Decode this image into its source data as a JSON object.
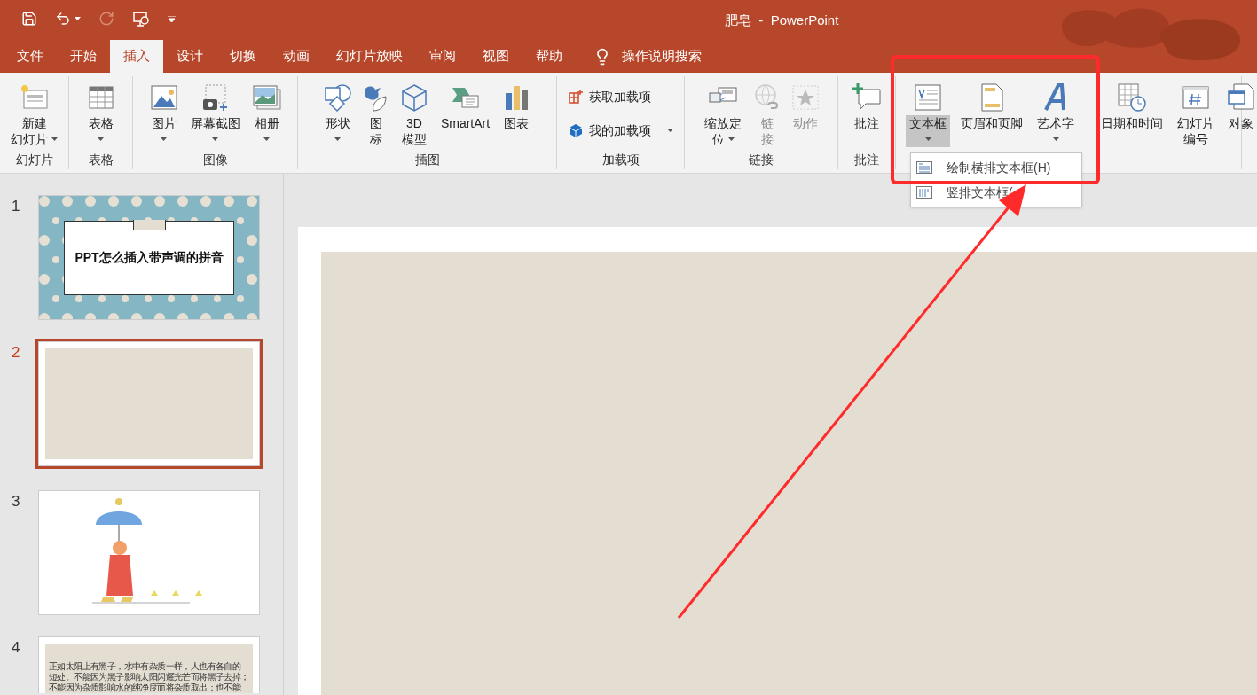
{
  "window": {
    "title": "肥皂  -  PowerPoint"
  },
  "tabs": [
    {
      "label": "文件",
      "selected": false
    },
    {
      "label": "开始",
      "selected": false
    },
    {
      "label": "插入",
      "selected": true
    },
    {
      "label": "设计",
      "selected": false
    },
    {
      "label": "切换",
      "selected": false
    },
    {
      "label": "动画",
      "selected": false
    },
    {
      "label": "幻灯片放映",
      "selected": false
    },
    {
      "label": "审阅",
      "selected": false
    },
    {
      "label": "视图",
      "selected": false
    },
    {
      "label": "帮助",
      "selected": false
    }
  ],
  "tell_me": {
    "placeholder": "操作说明搜索"
  },
  "ribbon": [
    {
      "label": "幻灯片",
      "buttons": [
        {
          "kind": "large",
          "lines": [
            "新建",
            "幻灯片"
          ],
          "caret": true
        }
      ]
    },
    {
      "label": "表格",
      "buttons": [
        {
          "kind": "large",
          "lines": [
            "表格"
          ],
          "caret": true
        }
      ]
    },
    {
      "label": "图像",
      "buttons": [
        {
          "kind": "large",
          "lines": [
            "图片"
          ],
          "caret": true
        },
        {
          "kind": "large",
          "lines": [
            "屏幕截图"
          ],
          "caret": true
        },
        {
          "kind": "large",
          "lines": [
            "相册"
          ],
          "caret": true
        }
      ]
    },
    {
      "label": "插图",
      "buttons": [
        {
          "kind": "large",
          "lines": [
            "形状"
          ],
          "caret": true
        },
        {
          "kind": "large",
          "lines": [
            "图",
            "标"
          ]
        },
        {
          "kind": "large",
          "lines": [
            "3D",
            "模型"
          ]
        },
        {
          "kind": "large",
          "lines": [
            "SmartArt"
          ]
        },
        {
          "kind": "large",
          "lines": [
            "图表"
          ]
        }
      ]
    },
    {
      "label": "加载项",
      "buttons": [
        {
          "kind": "small",
          "lines": [
            "获取加载项"
          ]
        },
        {
          "kind": "small",
          "lines": [
            "我的加载项"
          ],
          "caret": true
        }
      ]
    },
    {
      "label": "链接",
      "buttons": [
        {
          "kind": "large",
          "lines": [
            "缩放定",
            "位"
          ],
          "caret": true
        },
        {
          "kind": "large",
          "lines": [
            "链",
            "接"
          ],
          "disabled": true
        },
        {
          "kind": "large",
          "lines": [
            "动作"
          ],
          "disabled": true
        }
      ]
    },
    {
      "label": "批注",
      "buttons": [
        {
          "kind": "large",
          "lines": [
            "批注"
          ]
        }
      ]
    },
    {
      "buttons": [
        {
          "kind": "large",
          "lines": [
            "文本框"
          ],
          "caret": true,
          "pressed": true
        },
        {
          "kind": "large",
          "lines": [
            "页眉和页脚"
          ]
        },
        {
          "kind": "large",
          "lines": [
            "艺术字"
          ],
          "caret": true
        },
        {
          "kind": "large",
          "lines": [
            "日期和时间"
          ]
        },
        {
          "kind": "large",
          "lines": [
            "幻灯片",
            "编号"
          ]
        },
        {
          "kind": "large",
          "lines": [
            "对象"
          ]
        }
      ]
    }
  ],
  "dropdown": {
    "items": [
      {
        "label": "绘制横排文本框(H)"
      },
      {
        "label": "竖排文本框("
      }
    ]
  },
  "slides": [
    {
      "number": "1",
      "kind": "title",
      "selected": false,
      "title": "PPT怎么插入带声调的拼音"
    },
    {
      "number": "2",
      "kind": "blank",
      "selected": true
    },
    {
      "number": "3",
      "kind": "picture",
      "selected": false
    },
    {
      "number": "4",
      "kind": "text",
      "selected": false,
      "lines": [
        "正如太阳上有黑子，水中有杂质一样，人也有各自的",
        "短处。不能因为黑子影响太阳闪耀光芒而将黑子去掉；",
        "不能因为杂质影响水的纯净度而将杂质取出；也不能"
      ]
    }
  ]
}
